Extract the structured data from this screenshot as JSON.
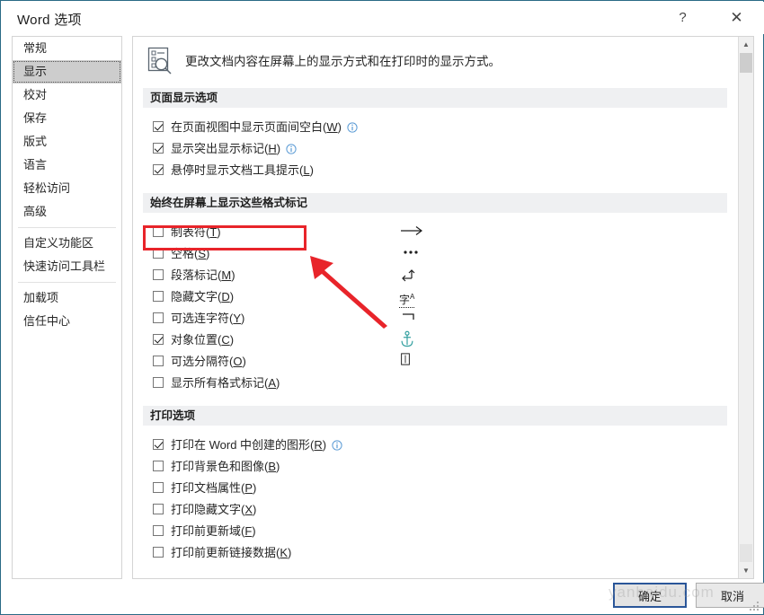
{
  "window": {
    "title": "Word 选项",
    "help_label": "?",
    "close_label": "✕"
  },
  "sidebar": {
    "items": [
      {
        "label": "常规",
        "selected": false
      },
      {
        "label": "显示",
        "selected": true
      },
      {
        "label": "校对",
        "selected": false
      },
      {
        "label": "保存",
        "selected": false
      },
      {
        "label": "版式",
        "selected": false
      },
      {
        "label": "语言",
        "selected": false
      },
      {
        "label": "轻松访问",
        "selected": false
      },
      {
        "label": "高级",
        "selected": false
      },
      {
        "label": "自定义功能区",
        "selected": false
      },
      {
        "label": "快速访问工具栏",
        "selected": false
      },
      {
        "label": "加载项",
        "selected": false
      },
      {
        "label": "信任中心",
        "selected": false
      }
    ]
  },
  "pane": {
    "header_text": "更改文档内容在屏幕上的显示方式和在打印时的显示方式。",
    "header_icon": "document-search-icon",
    "sections": [
      {
        "title": "页面显示选项",
        "options": [
          {
            "label": "在页面视图中显示页面间空白",
            "accel": "W",
            "checked": true,
            "info": true
          },
          {
            "label": "显示突出显示标记",
            "accel": "H",
            "checked": true,
            "info": true
          },
          {
            "label": "悬停时显示文档工具提示",
            "accel": "L",
            "checked": true,
            "info": false
          }
        ]
      },
      {
        "title": "始终在屏幕上显示这些格式标记",
        "options": [
          {
            "label": "制表符",
            "accel": "T",
            "checked": false,
            "glyph": "tab-arrow"
          },
          {
            "label": "空格",
            "accel": "S",
            "checked": false,
            "glyph": "space-dots"
          },
          {
            "label": "段落标记",
            "accel": "M",
            "checked": false,
            "glyph": "pilcrow-return"
          },
          {
            "label": "隐藏文字",
            "accel": "D",
            "checked": false,
            "glyph": "hidden-text"
          },
          {
            "label": "可选连字符",
            "accel": "Y",
            "checked": false,
            "glyph": "optional-hyphen"
          },
          {
            "label": "对象位置",
            "accel": "C",
            "checked": true,
            "glyph": "anchor"
          },
          {
            "label": "可选分隔符",
            "accel": "O",
            "checked": false,
            "glyph": "optional-break"
          },
          {
            "label": "显示所有格式标记",
            "accel": "A",
            "checked": false,
            "glyph": ""
          }
        ]
      },
      {
        "title": "打印选项",
        "options": [
          {
            "label": "打印在 Word 中创建的图形",
            "accel": "R",
            "checked": true,
            "info": true
          },
          {
            "label": "打印背景色和图像",
            "accel": "B",
            "checked": false,
            "info": false
          },
          {
            "label": "打印文档属性",
            "accel": "P",
            "checked": false,
            "info": false
          },
          {
            "label": "打印隐藏文字",
            "accel": "X",
            "checked": false,
            "info": false
          },
          {
            "label": "打印前更新域",
            "accel": "F",
            "checked": false,
            "info": false
          },
          {
            "label": "打印前更新链接数据",
            "accel": "K",
            "checked": false,
            "info": false
          }
        ]
      }
    ]
  },
  "footer": {
    "ok_label": "确定",
    "cancel_label": "取消"
  },
  "annotation": {
    "color": "#e8242a",
    "highlight_target": "制表符",
    "arrow": "points-up-left-to-tab-row"
  },
  "watermark": {
    "text": "yanbaidu.com"
  }
}
